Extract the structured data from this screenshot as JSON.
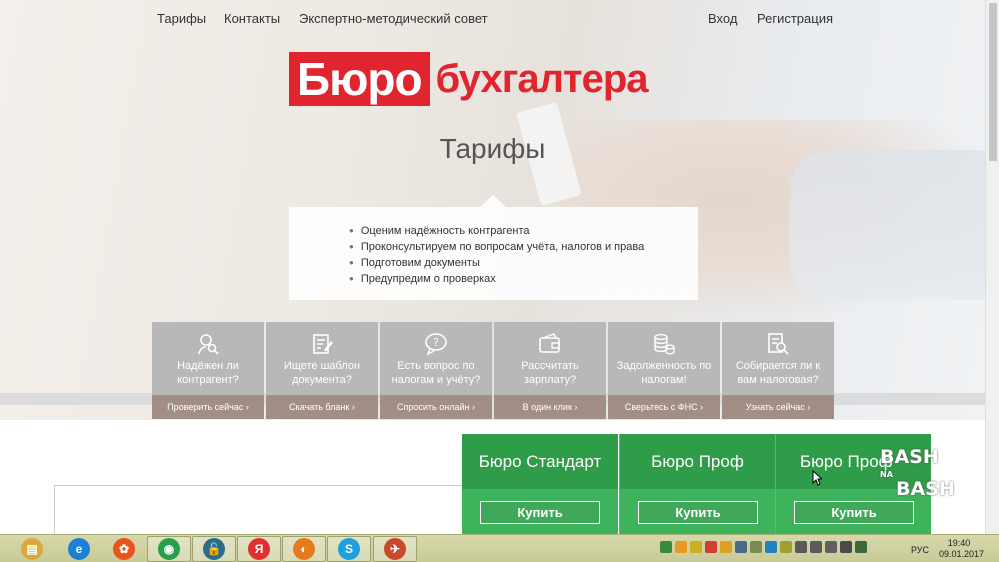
{
  "nav": {
    "left": [
      "Тарифы",
      "Контакты",
      "Экспертно-методический совет"
    ],
    "login": "Вход",
    "register": "Регистрация"
  },
  "logo": {
    "part1": "Бюро",
    "part2": "бухгалтера"
  },
  "page_title": "Тарифы",
  "benefits": [
    "Оценим надёжность контрагента",
    "Проконсультируем по вопросам учёта, налогов и права",
    "Подготовим документы",
    "Предупредим о проверках"
  ],
  "services": [
    {
      "icon": "search-person-icon",
      "text": "Надёжен ли контрагент?",
      "action": "Проверить сейчас ›"
    },
    {
      "icon": "document-edit-icon",
      "text": "Ищете шаблон документа?",
      "action": "Скачать бланк ›"
    },
    {
      "icon": "chat-question-icon",
      "text": "Есть вопрос по налогам и учёту?",
      "action": "Спросить онлайн ›"
    },
    {
      "icon": "wallet-icon",
      "text": "Рассчитать зарплату?",
      "action": "В один клик ›"
    },
    {
      "icon": "coins-icon",
      "text": "Задолженность по налогам!",
      "action": "Сверьтесь с ФНС ›"
    },
    {
      "icon": "doc-search-icon",
      "text": "Собирается ли к вам налоговая?",
      "action": "Узнать сейчас ›"
    }
  ],
  "plans": [
    {
      "name": "Бюро Стандарт",
      "buy": "Купить"
    },
    {
      "name": "Бюро Проф",
      "buy": "Купить"
    },
    {
      "name": "Бюро Проф",
      "buy": "Купить"
    }
  ],
  "watermark": {
    "top": "BASH",
    "mid": "NA",
    "bottom": "BASH"
  },
  "taskbar": {
    "apps": [
      {
        "icon": "file-explorer-icon",
        "color": "#d9a93b",
        "glyph": "▤"
      },
      {
        "icon": "internet-explorer-icon",
        "color": "#1e7fd6",
        "glyph": "e"
      },
      {
        "icon": "media-player-icon",
        "color": "#e8541b",
        "glyph": "✿"
      },
      {
        "icon": "chrome-icon",
        "color": "#2a9d4a",
        "glyph": "◉"
      },
      {
        "icon": "vpn-lock-icon",
        "color": "#2b6c8a",
        "glyph": "🔓"
      },
      {
        "icon": "yandex-browser-icon",
        "color": "#e03030",
        "glyph": "Я"
      },
      {
        "icon": "firefox-icon",
        "color": "#e67a1e",
        "glyph": "◐"
      },
      {
        "icon": "skype-icon",
        "color": "#1da0e0",
        "glyph": "S"
      },
      {
        "icon": "yandex-icon",
        "color": "#c94a2a",
        "glyph": "✈"
      }
    ],
    "lang": "РУС",
    "time": "19:40",
    "date": "09.01.2017"
  }
}
